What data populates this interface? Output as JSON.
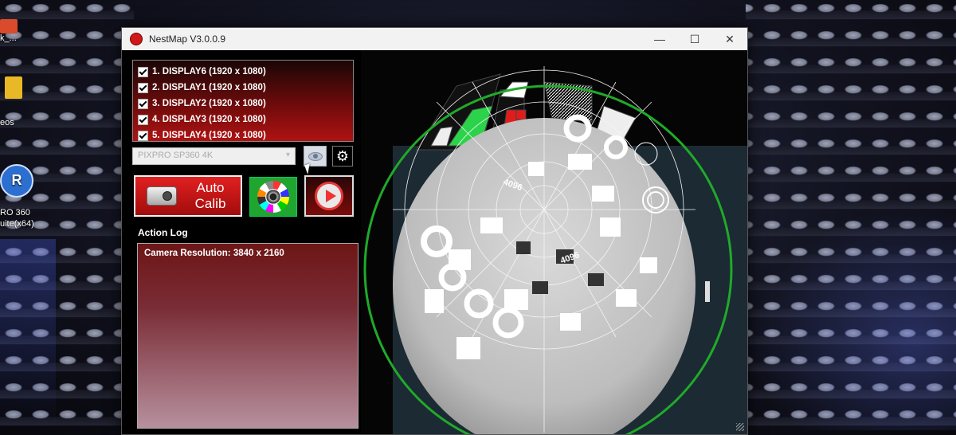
{
  "desktop": {
    "icons": [
      {
        "label": "k_..."
      },
      {
        "label": "eos"
      },
      {
        "label": "RO 360\nuite(x64)"
      }
    ]
  },
  "window": {
    "title": "NestMap V3.0.0.9",
    "controls": {
      "minimize": "—",
      "maximize": "☐",
      "close": "✕"
    }
  },
  "displays": [
    {
      "label": "1. DISPLAY6 (1920 x 1080)",
      "checked": true
    },
    {
      "label": "2. DISPLAY1 (1920 x 1080)",
      "checked": true
    },
    {
      "label": "3. DISPLAY2 (1920 x 1080)",
      "checked": true
    },
    {
      "label": "4. DISPLAY3 (1920 x 1080)",
      "checked": true
    },
    {
      "label": "5. DISPLAY4 (1920 x 1080)",
      "checked": true
    }
  ],
  "camera": {
    "selected": "PIXPRO SP360 4K"
  },
  "buttons": {
    "auto_calib": "Auto\nCalib"
  },
  "action_log": {
    "label": "Action Log",
    "entries": [
      "Camera Resolution: 3840 x 2160"
    ]
  },
  "preview": {
    "tag_1": "4096",
    "tag_2": "4096",
    "ring_color": "#1faa2a"
  }
}
